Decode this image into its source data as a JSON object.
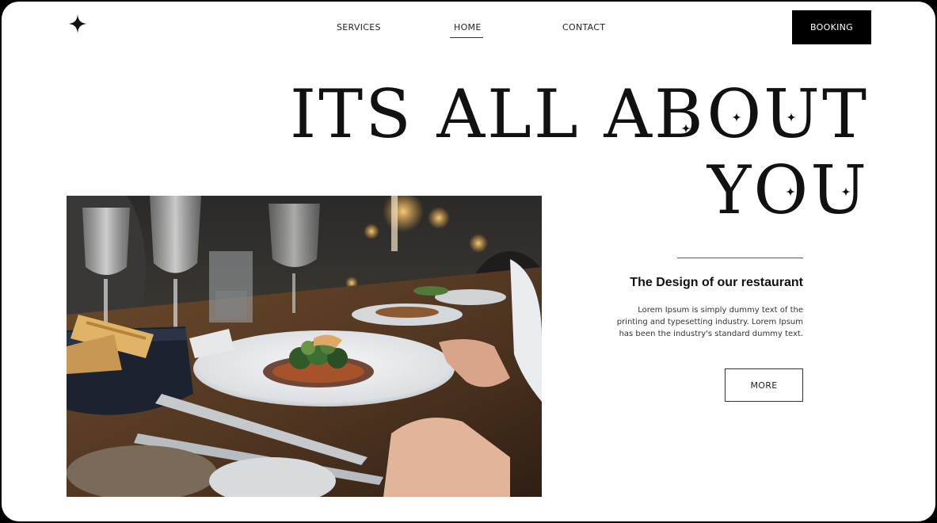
{
  "nav": {
    "items": [
      {
        "label": "SERVICES"
      },
      {
        "label": "HOME"
      },
      {
        "label": "CONTACT"
      }
    ],
    "active": "HOME",
    "booking_label": "BOOKING"
  },
  "hero": {
    "line1": "ITS ALL ABOUT",
    "line2": "YOU"
  },
  "section": {
    "title": "The Design of our restaurant",
    "body": "Lorem Ipsum is simply dummy text of the printing and typesetting industry. Lorem Ipsum has been the industry's standard dummy text.",
    "more_label": "MORE"
  },
  "icons": {
    "logo": "four-point-star-icon",
    "sparkle": "sparkle-icon"
  },
  "colors": {
    "background": "#ffffff",
    "text": "#111111",
    "button_dark": "#000000",
    "frame": "#000000"
  }
}
